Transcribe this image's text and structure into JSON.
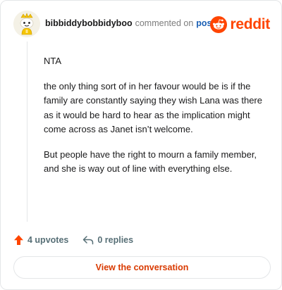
{
  "header": {
    "username": "bibbiddybobbidyboo",
    "commented_text": "commented on",
    "post_link": "post",
    "brand": "reddit"
  },
  "comment": {
    "paragraphs": [
      "NTA",
      "the only thing sort of in her favour would be is if the family are constantly saying they wish Lana was there as it would be hard to hear as the implication might come across as Janet isn’t welcome.",
      "But people have the right to mourn a family member, and she is way out of line with everything else."
    ]
  },
  "actions": {
    "upvotes": "4 upvotes",
    "replies": "0 replies"
  },
  "cta": {
    "label": "View the conversation"
  },
  "colors": {
    "brand": "#ff4500",
    "upvote": "#ff4500",
    "link": "#1a5fb4",
    "cta_text": "#d93a00"
  },
  "icons": {
    "avatar": "snoo-avatar",
    "brand": "reddit-logo-icon",
    "upvote": "upvote-arrow-icon",
    "reply": "reply-arrow-icon"
  }
}
